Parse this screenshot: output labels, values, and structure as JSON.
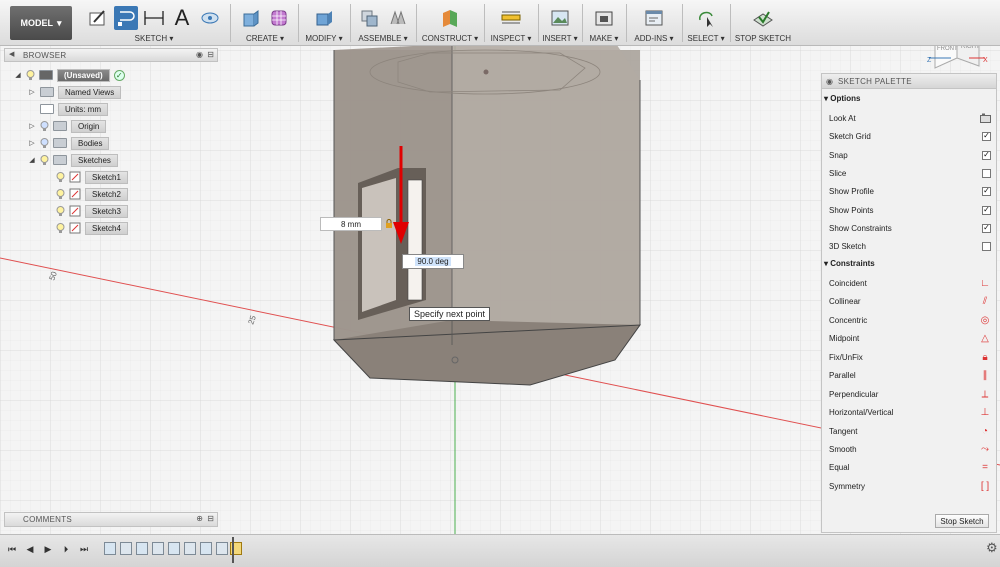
{
  "toolbar": {
    "model_label": "MODEL",
    "groups": [
      {
        "label": "SKETCH ▾"
      },
      {
        "label": "CREATE ▾"
      },
      {
        "label": "MODIFY ▾"
      },
      {
        "label": "ASSEMBLE ▾"
      },
      {
        "label": "CONSTRUCT ▾"
      },
      {
        "label": "INSPECT ▾"
      },
      {
        "label": "INSERT ▾"
      },
      {
        "label": "MAKE ▾"
      },
      {
        "label": "ADD-INS ▾"
      },
      {
        "label": "SELECT ▾"
      },
      {
        "label": "STOP SKETCH"
      }
    ],
    "text_icon": "A"
  },
  "browser": {
    "title": "BROWSER",
    "root": "(Unsaved)",
    "named_views": "Named Views",
    "units": "Units: mm",
    "origin": "Origin",
    "bodies": "Bodies",
    "sketches": "Sketches",
    "sketch_items": [
      "Sketch1",
      "Sketch2",
      "Sketch3",
      "Sketch4"
    ]
  },
  "comments": {
    "title": "COMMENTS"
  },
  "canvas": {
    "dimension_length": "8 mm",
    "dimension_angle": "90.0 deg",
    "tooltip": "Specify next point",
    "axis_labels": [
      "50",
      "25"
    ],
    "viewcube_front": "FRONT",
    "viewcube_right": "RIGHT",
    "axis_z": "Z",
    "axis_x": "X"
  },
  "palette": {
    "title": "SKETCH PALETTE",
    "options_header": "Options",
    "options": [
      {
        "label": "Look At",
        "type": "icon"
      },
      {
        "label": "Sketch Grid",
        "checked": true
      },
      {
        "label": "Snap",
        "checked": true
      },
      {
        "label": "Slice",
        "checked": false
      },
      {
        "label": "Show Profile",
        "checked": true
      },
      {
        "label": "Show Points",
        "checked": true
      },
      {
        "label": "Show Constraints",
        "checked": true
      },
      {
        "label": "3D Sketch",
        "checked": false
      }
    ],
    "constraints_header": "Constraints",
    "constraints": [
      {
        "label": "Coincident",
        "icon": "coincident-icon"
      },
      {
        "label": "Collinear",
        "icon": "collinear-icon"
      },
      {
        "label": "Concentric",
        "icon": "concentric-icon"
      },
      {
        "label": "Midpoint",
        "icon": "midpoint-icon"
      },
      {
        "label": "Fix/UnFix",
        "icon": "lock-icon"
      },
      {
        "label": "Parallel",
        "icon": "parallel-icon"
      },
      {
        "label": "Perpendicular",
        "icon": "perpendicular-icon"
      },
      {
        "label": "Horizontal/Vertical",
        "icon": "horizontal-vertical-icon"
      },
      {
        "label": "Tangent",
        "icon": "tangent-icon"
      },
      {
        "label": "Smooth",
        "icon": "smooth-icon"
      },
      {
        "label": "Equal",
        "icon": "equal-icon"
      },
      {
        "label": "Symmetry",
        "icon": "symmetry-icon"
      }
    ],
    "stop_sketch_button": "Stop Sketch"
  },
  "colors": {
    "accent": "#3b78b5",
    "constraint_red": "#d33333",
    "axis_red": "#e05050",
    "axis_green": "#4caf50"
  }
}
